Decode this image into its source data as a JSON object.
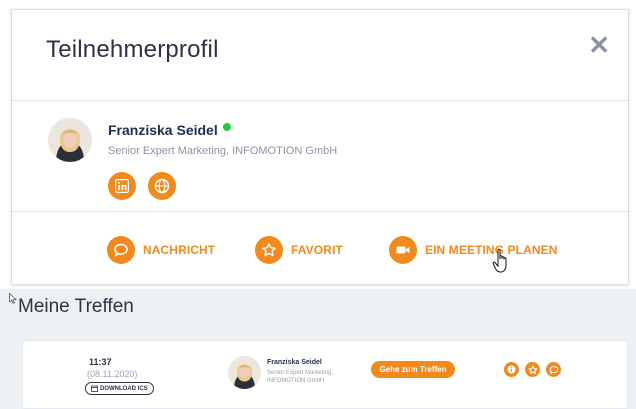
{
  "modal": {
    "title": "Teilnehmerprofil",
    "close_icon": "close-icon"
  },
  "profile": {
    "name": "Franziska Seidel",
    "status": "online",
    "status_color": "#28c840",
    "role": "Senior Expert Marketing, INFOMOTION GmbH",
    "social": [
      {
        "icon": "linkedin-icon"
      },
      {
        "icon": "globe-icon"
      }
    ]
  },
  "actions": {
    "message_label": "NACHRICHT",
    "favorite_label": "FAVORIT",
    "meeting_label": "EIN MEETING PLANEN"
  },
  "meetings": {
    "section_title": "Meine Treffen",
    "items": [
      {
        "time": "11:37",
        "date": "(08.11.2020)",
        "ics_label": "DOWNLOAD ICS",
        "name": "Franziska Seidel",
        "role": "Senior Expert Marketing, INFOMOTION GmbH",
        "join_label": "Gehe zum Treffen",
        "icons": [
          "info-icon",
          "star-icon",
          "chat-icon"
        ]
      }
    ]
  },
  "colors": {
    "accent": "#f08a1c",
    "text_dark": "#1f2d52",
    "muted": "#8c94a2",
    "lower_bg": "#eef1f4"
  }
}
